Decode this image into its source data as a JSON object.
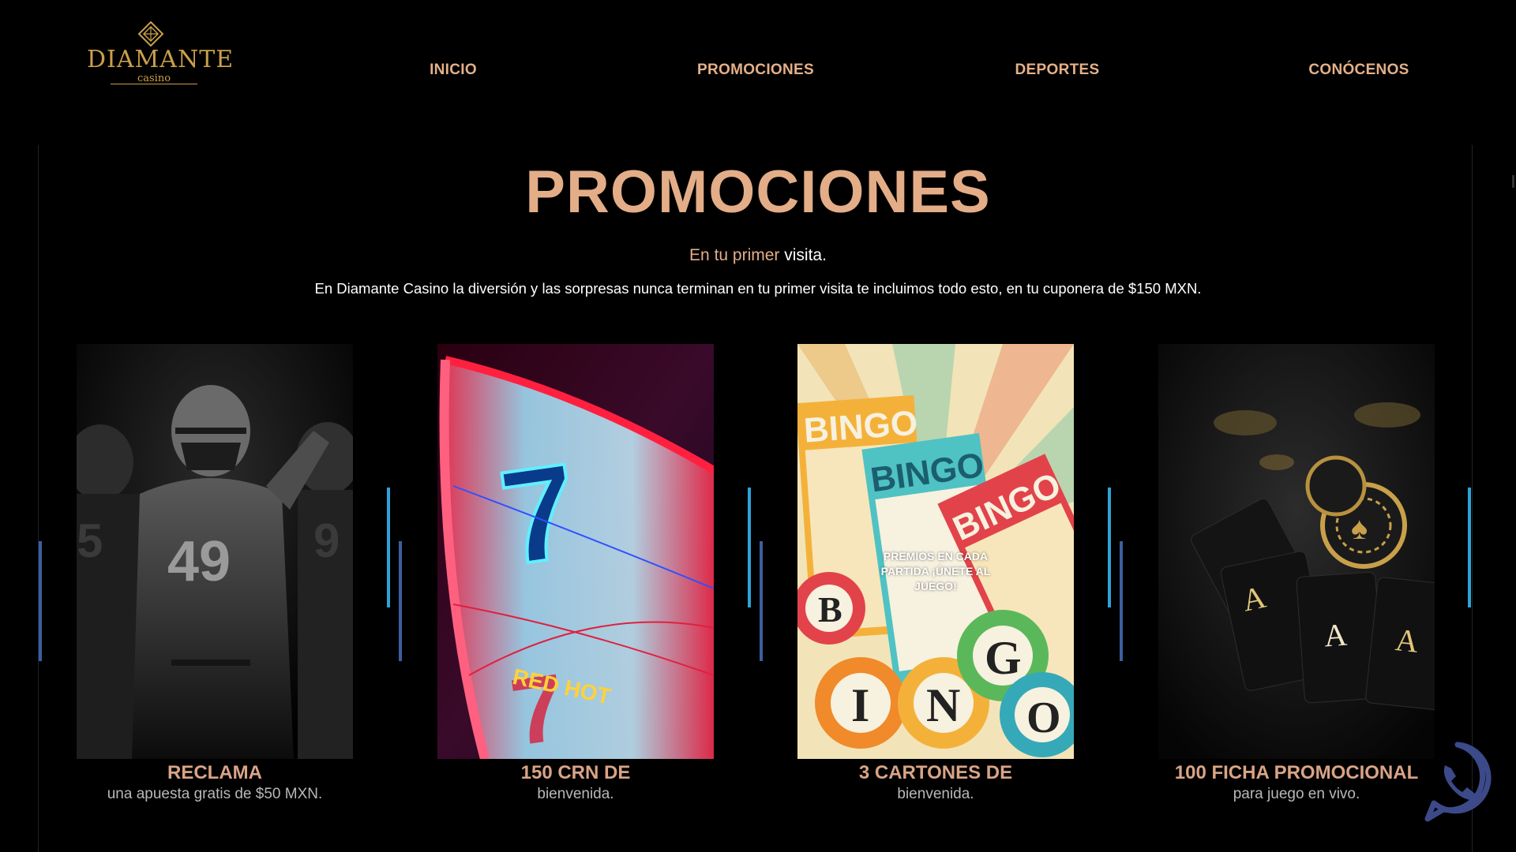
{
  "brand": {
    "name": "DIAMANTE",
    "sub": "casino"
  },
  "nav": {
    "items": [
      {
        "label": "INICIO"
      },
      {
        "label": "PROMOCIONES"
      },
      {
        "label": "DEPORTES"
      },
      {
        "label": "CONÓCENOS"
      }
    ]
  },
  "section": {
    "title": "PROMOCIONES",
    "subtitle_gold": "En tu primer",
    "subtitle_white": "visita.",
    "description": "En Diamante Casino la diversión y las sorpresas nunca terminan en tu primer visita te incluimos todo esto, en tu cuponera de $150 MXN."
  },
  "cards": [
    {
      "title": "RECLAMA",
      "text": "una apuesta gratis de $50 MXN.",
      "image": "football-players"
    },
    {
      "title": "150 CRN DE",
      "text": "bienvenida.",
      "image": "slot-machine"
    },
    {
      "title": "3 CARTONES DE",
      "text": "bienvenida.",
      "image": "bingo",
      "caption": "PREMIOS EN CADA PARTIDA ¡ÚNETE AL JUEGO!"
    },
    {
      "title": "100 FICHA PROMOCIONAL",
      "text": "para juego en vivo.",
      "image": "poker-cards"
    }
  ],
  "colors": {
    "accent": "#e3ad88",
    "logo_gold": "#c9a04a",
    "bar_blue": "#3b5fa0",
    "bar_cyan": "#2fa3d6"
  },
  "icons": [
    "diamond-logo-icon",
    "phone-chat-icon"
  ]
}
